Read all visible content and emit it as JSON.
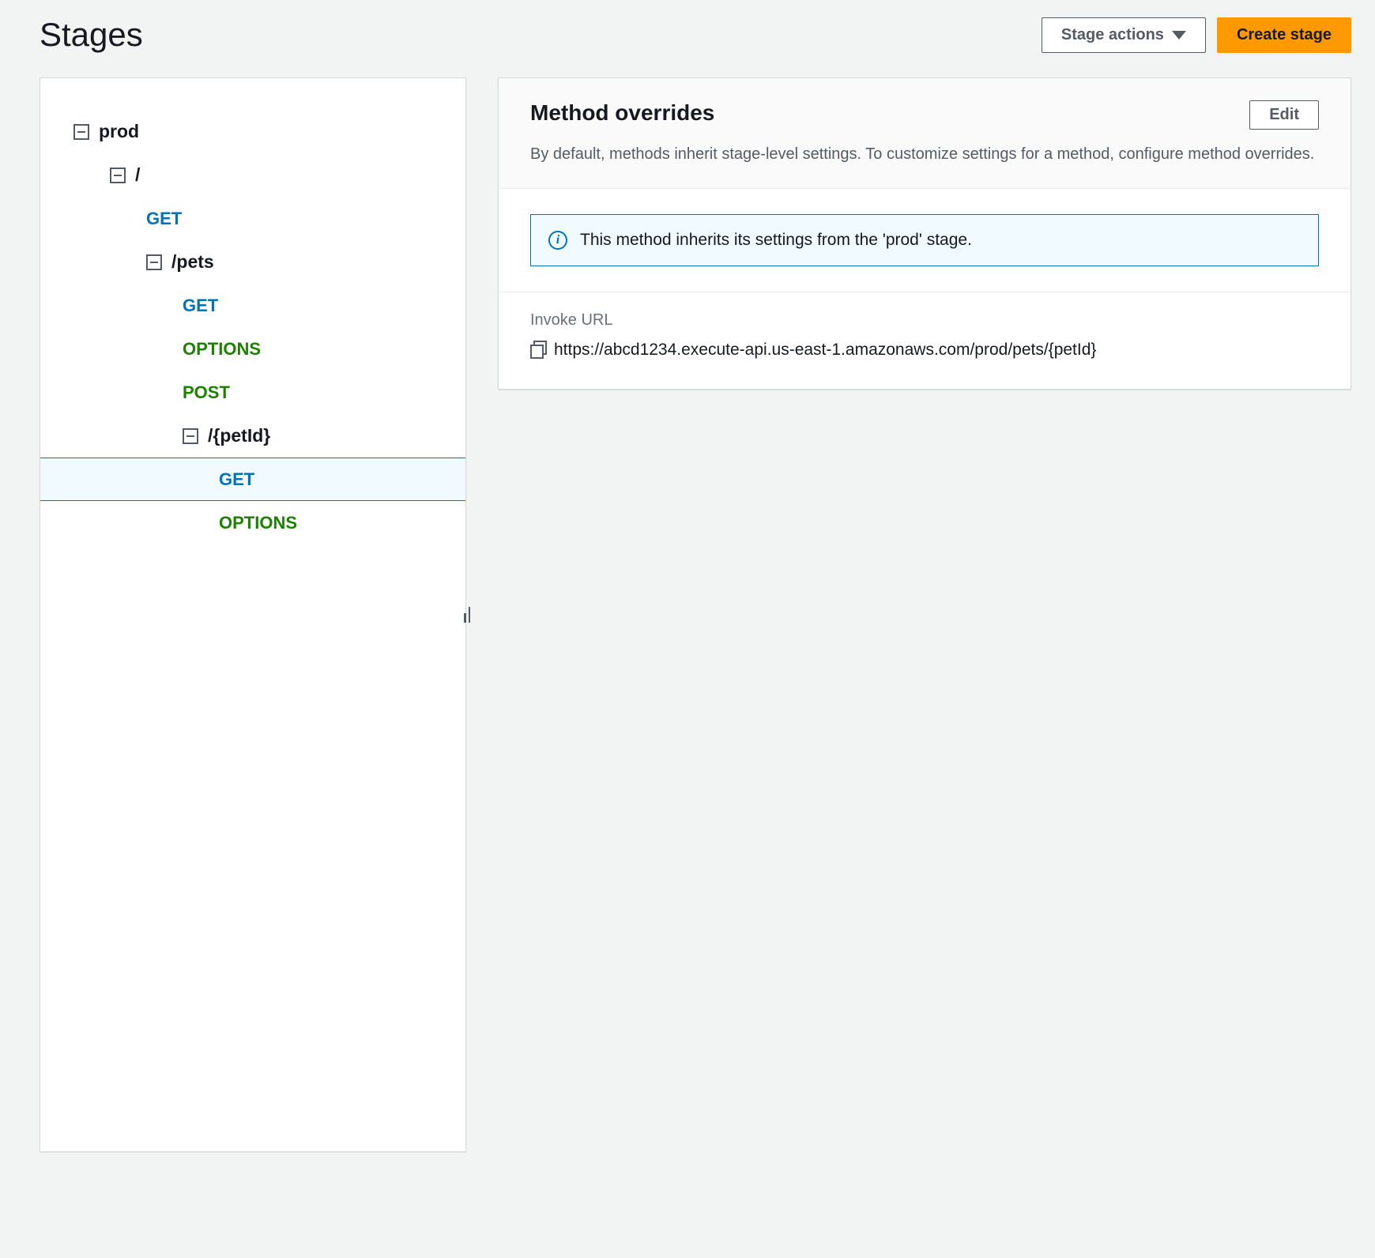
{
  "header": {
    "title": "Stages",
    "stage_actions_label": "Stage actions",
    "create_stage_label": "Create stage"
  },
  "tree": {
    "stage": "prod",
    "root_path": "/",
    "root_get": "GET",
    "pets_path": "/pets",
    "pets_get": "GET",
    "pets_options": "OPTIONS",
    "pets_post": "POST",
    "petid_path": "/{petId}",
    "petid_get": "GET",
    "petid_options": "OPTIONS"
  },
  "detail": {
    "title": "Method overrides",
    "edit_label": "Edit",
    "description": "By default, methods inherit stage-level settings. To customize settings for a method, configure method overrides.",
    "info_message": "This method inherits its settings from the 'prod' stage.",
    "invoke_label": "Invoke URL",
    "invoke_url": "https://abcd1234.execute-api.us-east-1.amazonaws.com/prod/pets/{petId}"
  }
}
